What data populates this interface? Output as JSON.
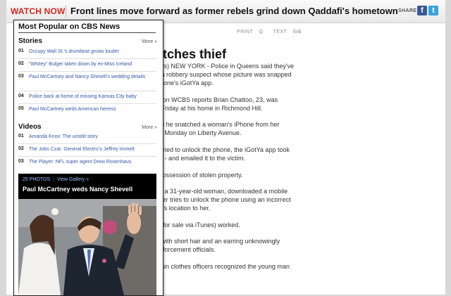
{
  "topbar": {
    "watch_now": "WATCH NOW",
    "headline": "Front lines move forward as former rebels grind down Qaddafi's hometown",
    "share": "SHARE",
    "facebook_glyph": "f",
    "twitter_glyph": "t"
  },
  "article": {
    "tools": {
      "print": "PRINT",
      "text": "TEXT"
    },
    "title": "atches thief",
    "paragraphs": [
      "ews)  NEW YORK - Police in Queens said they've",
      "d a robbery suspect whose picture was snapped",
      "Phone's iGotYa app.",
      "ation WCBS reports Brian Chattoo, 23, was",
      "d Friday at his home in Richmond Hill.",
      "aid he snatched a woman's iPhone from her",
      "on Monday on Liberty Avenue.",
      "e tried to unlock the phone, the iGotYa app took",
      "ire - and emailed it to the victim.",
      "l possession of stolen property.",
      "er, a 31-year-old woman, downloaded a mobile",
      "ever tries to unlock the phone using an incorrect",
      "ne's location to her.",
      "ot for sale via iTunes) worked.",
      "n with short hair and an earring unknowingly",
      "enforcement officials.",
      "plain clothes officers recognized the young man"
    ]
  },
  "popular": {
    "title": "Most Popular on CBS News",
    "stories": {
      "label": "Stories",
      "more": "More »",
      "items": [
        {
          "num": "01",
          "text": "Occupy Wall St.'s drumbeat grows louder"
        },
        {
          "num": "02",
          "text": "\"Whitey\" Bulger taken down by ex-Miss Iceland"
        },
        {
          "num": "03",
          "text": "Paul McCartney and Nancy Shevell's wedding details"
        },
        {
          "num": "04",
          "text": "Police back at home of missing Kansas City baby"
        },
        {
          "num": "05",
          "text": "Paul McCartney weds American heiress"
        }
      ]
    },
    "videos": {
      "label": "Videos",
      "more": "More »",
      "items": [
        {
          "num": "01",
          "text": "Amanda Knox: The untold story"
        },
        {
          "num": "02",
          "text": "The Jobs Czar: General Electric's Jeffrey Immelt"
        },
        {
          "num": "03",
          "text": "The Player: NFL super agent Drew Rosenhaus"
        }
      ]
    },
    "gallery": {
      "count": "25 PHOTOS",
      "view": "View Gallery »",
      "caption": "Paul McCartney weds Nancy Shevell"
    }
  },
  "colors": {
    "accent_red": "#d8261c",
    "link_blue": "#3556a8",
    "facebook": "#3b5998",
    "twitter": "#3aa3d9"
  }
}
